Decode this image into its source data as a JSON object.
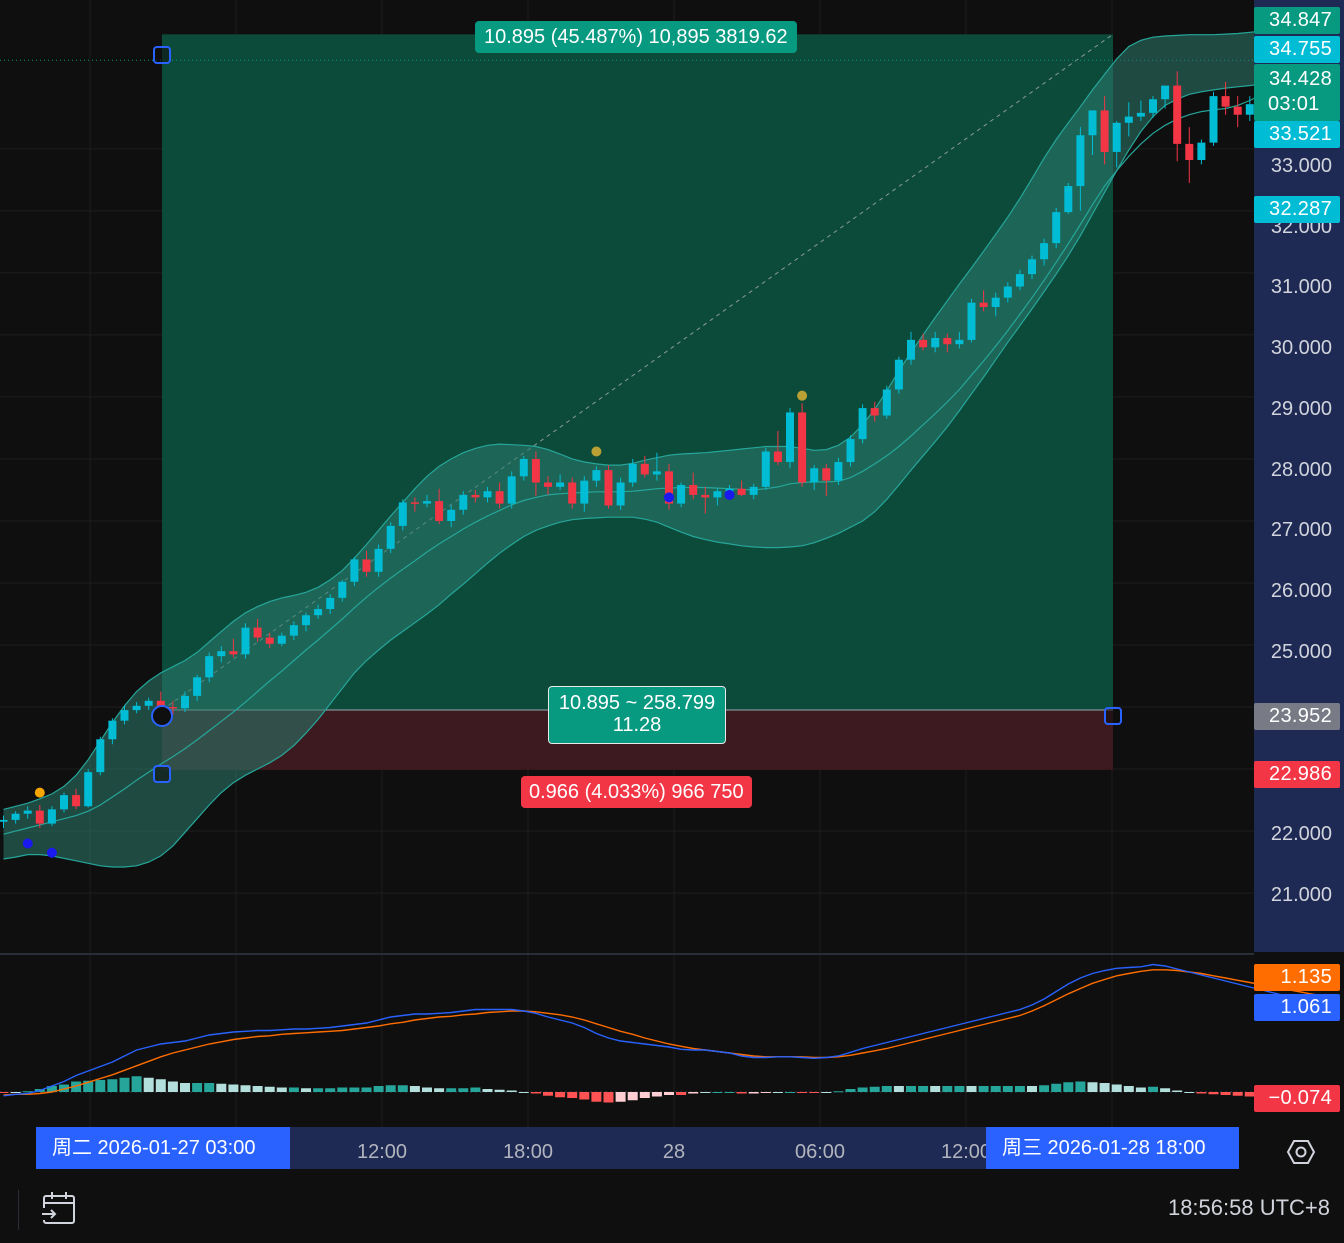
{
  "colors": {
    "background": "#0f0f0f",
    "up_candle": "#00bcd4",
    "down_candle": "#f23645",
    "profit_zone": "#0c4a3a",
    "loss_zone": "#3d1a1f",
    "bollinger_fill": "#2b7c6e",
    "macd_line": "#2962ff",
    "signal_line": "#ff6d00",
    "price_axis_panel": "#1e2a54"
  },
  "chart_data": {
    "type": "candlestick",
    "interval": "15m",
    "price_axis": {
      "ticks": [
        "33.000",
        "32.000",
        "31.000",
        "30.000",
        "29.000",
        "28.000",
        "27.000",
        "26.000",
        "25.000",
        "22.000",
        "21.000"
      ],
      "ylim": [
        20.05,
        35.4
      ]
    },
    "price_labels": [
      {
        "value": "34.847",
        "color": "#089981",
        "text2": ""
      },
      {
        "value": "34.755",
        "color": "#00bcd4",
        "text2": ""
      },
      {
        "value": "34.428",
        "color": "#089981",
        "text2": "03:01"
      },
      {
        "value": "33.521",
        "color": "#00bcd4",
        "text2": ""
      },
      {
        "value": "32.287",
        "color": "#00bcd4",
        "text2": ""
      },
      {
        "value": "23.952",
        "color": "#787b86",
        "text2": ""
      },
      {
        "value": "22.986",
        "color": "#f23645",
        "text2": ""
      }
    ],
    "time_axis": {
      "ticks": [
        "12:00",
        "18:00",
        "28",
        "06:00",
        "12:00"
      ],
      "range_start": "周二 2026-01-27   03:00",
      "range_end": "周三 2026-01-28   18:00"
    },
    "candles": [
      [
        22.15,
        22.25,
        22.05,
        22.18
      ],
      [
        22.18,
        22.32,
        22.12,
        22.28
      ],
      [
        22.28,
        22.4,
        22.2,
        22.33
      ],
      [
        22.33,
        22.42,
        22.05,
        22.12
      ],
      [
        22.12,
        22.4,
        22.08,
        22.35
      ],
      [
        22.35,
        22.62,
        22.3,
        22.58
      ],
      [
        22.58,
        22.68,
        22.35,
        22.4
      ],
      [
        22.4,
        23.0,
        22.38,
        22.95
      ],
      [
        22.95,
        23.52,
        22.9,
        23.48
      ],
      [
        23.48,
        23.82,
        23.4,
        23.78
      ],
      [
        23.78,
        24.02,
        23.72,
        23.95
      ],
      [
        23.95,
        24.08,
        23.9,
        24.02
      ],
      [
        24.02,
        24.15,
        23.95,
        24.1
      ],
      [
        24.1,
        24.25,
        23.95,
        24.0
      ],
      [
        24.0,
        24.1,
        23.88,
        23.98
      ],
      [
        23.98,
        24.25,
        23.92,
        24.18
      ],
      [
        24.18,
        24.52,
        24.1,
        24.48
      ],
      [
        24.48,
        24.88,
        24.4,
        24.82
      ],
      [
        24.82,
        24.98,
        24.72,
        24.9
      ],
      [
        24.9,
        25.1,
        24.8,
        24.85
      ],
      [
        24.85,
        25.35,
        24.78,
        25.28
      ],
      [
        25.28,
        25.42,
        25.05,
        25.12
      ],
      [
        25.12,
        25.2,
        24.95,
        25.02
      ],
      [
        25.02,
        25.2,
        24.98,
        25.15
      ],
      [
        25.15,
        25.38,
        25.08,
        25.32
      ],
      [
        25.32,
        25.52,
        25.22,
        25.48
      ],
      [
        25.48,
        25.65,
        25.42,
        25.58
      ],
      [
        25.58,
        25.82,
        25.5,
        25.76
      ],
      [
        25.76,
        26.05,
        25.7,
        26.02
      ],
      [
        26.02,
        26.42,
        25.95,
        26.38
      ],
      [
        26.38,
        26.52,
        26.1,
        26.18
      ],
      [
        26.18,
        26.62,
        26.1,
        26.55
      ],
      [
        26.55,
        26.98,
        26.48,
        26.92
      ],
      [
        26.92,
        27.35,
        26.85,
        27.3
      ],
      [
        27.3,
        27.38,
        27.15,
        27.28
      ],
      [
        27.28,
        27.42,
        27.22,
        27.32
      ],
      [
        27.32,
        27.52,
        26.95,
        27.0
      ],
      [
        27.0,
        27.25,
        26.9,
        27.18
      ],
      [
        27.18,
        27.48,
        27.1,
        27.42
      ],
      [
        27.42,
        27.5,
        27.3,
        27.38
      ],
      [
        27.38,
        27.55,
        27.3,
        27.48
      ],
      [
        27.48,
        27.62,
        27.2,
        27.28
      ],
      [
        27.28,
        27.8,
        27.2,
        27.72
      ],
      [
        27.72,
        28.05,
        27.65,
        28.0
      ],
      [
        28.0,
        28.12,
        27.4,
        27.62
      ],
      [
        27.62,
        27.72,
        27.42,
        27.55
      ],
      [
        27.55,
        27.75,
        27.5,
        27.62
      ],
      [
        27.62,
        27.7,
        27.2,
        27.28
      ],
      [
        27.28,
        27.72,
        27.15,
        27.65
      ],
      [
        27.65,
        27.88,
        27.55,
        27.82
      ],
      [
        27.82,
        27.9,
        27.2,
        27.25
      ],
      [
        27.25,
        27.7,
        27.18,
        27.62
      ],
      [
        27.62,
        28.0,
        27.55,
        27.92
      ],
      [
        27.92,
        28.05,
        27.7,
        27.75
      ],
      [
        27.75,
        28.1,
        27.65,
        27.8
      ],
      [
        27.8,
        27.92,
        27.18,
        27.28
      ],
      [
        27.28,
        27.62,
        27.22,
        27.58
      ],
      [
        27.58,
        27.78,
        27.35,
        27.42
      ],
      [
        27.42,
        27.55,
        27.12,
        27.38
      ],
      [
        27.38,
        27.52,
        27.25,
        27.48
      ],
      [
        27.48,
        27.58,
        27.36,
        27.52
      ],
      [
        27.52,
        27.65,
        27.4,
        27.42
      ],
      [
        27.42,
        27.6,
        27.35,
        27.55
      ],
      [
        27.55,
        28.18,
        27.5,
        28.12
      ],
      [
        28.12,
        28.45,
        27.9,
        27.95
      ],
      [
        27.95,
        28.82,
        27.85,
        28.75
      ],
      [
        28.75,
        28.9,
        27.55,
        27.62
      ],
      [
        27.62,
        27.9,
        27.5,
        27.85
      ],
      [
        27.85,
        27.92,
        27.4,
        27.65
      ],
      [
        27.65,
        28.02,
        27.58,
        27.95
      ],
      [
        27.95,
        28.38,
        27.88,
        28.32
      ],
      [
        28.32,
        28.88,
        28.25,
        28.82
      ],
      [
        28.82,
        28.92,
        28.6,
        28.7
      ],
      [
        28.7,
        29.18,
        28.65,
        29.12
      ],
      [
        29.12,
        29.65,
        29.05,
        29.6
      ],
      [
        29.6,
        30.05,
        29.52,
        29.92
      ],
      [
        29.92,
        30.02,
        29.75,
        29.8
      ],
      [
        29.8,
        30.05,
        29.72,
        29.95
      ],
      [
        29.95,
        30.02,
        29.72,
        29.85
      ],
      [
        29.85,
        30.05,
        29.78,
        29.92
      ],
      [
        29.92,
        30.58,
        29.88,
        30.52
      ],
      [
        30.52,
        30.72,
        30.38,
        30.45
      ],
      [
        30.45,
        30.68,
        30.3,
        30.6
      ],
      [
        30.6,
        30.85,
        30.52,
        30.78
      ],
      [
        30.78,
        31.05,
        30.72,
        30.98
      ],
      [
        30.98,
        31.28,
        30.9,
        31.22
      ],
      [
        31.22,
        31.55,
        31.12,
        31.48
      ],
      [
        31.48,
        32.05,
        31.4,
        31.98
      ],
      [
        31.98,
        32.45,
        31.95,
        32.4
      ],
      [
        32.4,
        33.35,
        32.0,
        33.22
      ],
      [
        33.22,
        33.45,
        32.9,
        33.62
      ],
      [
        33.62,
        33.85,
        32.75,
        32.95
      ],
      [
        32.95,
        33.45,
        32.7,
        33.42
      ],
      [
        33.42,
        33.75,
        33.2,
        33.52
      ],
      [
        33.52,
        33.78,
        33.45,
        33.58
      ],
      [
        33.58,
        33.85,
        33.5,
        33.8
      ],
      [
        33.8,
        34.0,
        33.65,
        34.02
      ],
      [
        34.02,
        34.25,
        32.8,
        33.08
      ],
      [
        33.08,
        33.35,
        32.45,
        32.82
      ],
      [
        32.82,
        33.15,
        32.75,
        33.1
      ],
      [
        33.1,
        33.92,
        33.05,
        33.85
      ],
      [
        33.85,
        34.08,
        33.55,
        33.68
      ],
      [
        33.68,
        33.85,
        33.35,
        33.55
      ],
      [
        33.55,
        33.85,
        33.45,
        33.72
      ],
      [
        33.72,
        33.85,
        33.5,
        33.75
      ],
      [
        33.75,
        34.02,
        33.7,
        33.92
      ],
      [
        33.92,
        34.65,
        33.88,
        34.6
      ],
      [
        34.6,
        34.72,
        34.2,
        34.32
      ],
      [
        34.32,
        34.76,
        34.22,
        34.36
      ]
    ],
    "bollinger": {
      "basis": [
        21.95,
        22.0,
        22.05,
        22.1,
        22.15,
        22.2,
        22.25,
        22.32,
        22.42,
        22.55,
        22.68,
        22.82,
        22.95,
        23.08,
        23.2,
        23.33,
        23.47,
        23.62,
        23.77,
        23.92,
        24.08,
        24.25,
        24.42,
        24.58,
        24.75,
        24.92,
        25.08,
        25.25,
        25.42,
        25.6,
        25.77,
        25.93,
        26.08,
        26.22,
        26.36,
        26.5,
        26.63,
        26.75,
        26.87,
        26.98,
        27.08,
        27.17,
        27.26,
        27.33,
        27.38,
        27.42,
        27.44,
        27.45,
        27.46,
        27.47,
        27.47,
        27.47,
        27.48,
        27.5,
        27.52,
        27.53,
        27.54,
        27.54,
        27.54,
        27.53,
        27.52,
        27.51,
        27.5,
        27.52,
        27.55,
        27.6,
        27.62,
        27.63,
        27.63,
        27.64,
        27.7,
        27.8,
        27.92,
        28.05,
        28.2,
        28.37,
        28.55,
        28.73,
        28.92,
        29.12,
        29.35,
        29.58,
        29.82,
        30.07,
        30.33,
        30.6,
        30.88,
        31.17,
        31.47,
        31.78,
        32.1,
        32.4,
        32.65,
        32.88,
        33.08,
        33.25,
        33.38,
        33.48,
        33.55,
        33.6,
        33.63,
        33.65,
        33.7,
        33.78,
        33.88,
        34.0,
        34.12,
        34.22,
        34.32,
        34.4,
        34.45
      ],
      "upper": [
        22.35,
        22.4,
        22.45,
        22.52,
        22.6,
        22.72,
        22.9,
        23.15,
        23.45,
        23.75,
        24.02,
        24.25,
        24.42,
        24.55,
        24.65,
        24.75,
        24.88,
        25.05,
        25.22,
        25.38,
        25.52,
        25.62,
        25.7,
        25.76,
        25.8,
        25.85,
        25.93,
        26.05,
        26.2,
        26.4,
        26.62,
        26.85,
        27.08,
        27.3,
        27.52,
        27.72,
        27.88,
        28.0,
        28.1,
        28.17,
        28.22,
        28.24,
        28.23,
        28.22,
        28.2,
        28.15,
        28.08,
        28.0,
        27.95,
        27.92,
        27.9,
        27.9,
        27.93,
        27.98,
        28.02,
        28.06,
        28.08,
        28.09,
        28.1,
        28.12,
        28.14,
        28.16,
        28.18,
        28.2,
        28.2,
        28.2,
        28.17,
        28.14,
        28.15,
        28.22,
        28.35,
        28.55,
        28.8,
        29.1,
        29.42,
        29.72,
        30.0,
        30.28,
        30.55,
        30.82,
        31.08,
        31.35,
        31.62,
        31.9,
        32.2,
        32.52,
        32.85,
        33.15,
        33.42,
        33.68,
        33.95,
        34.2,
        34.45,
        34.65,
        34.75,
        34.8,
        34.82,
        34.83,
        34.84,
        34.84,
        34.84,
        34.85,
        34.86,
        34.88,
        34.9,
        34.85,
        34.76,
        34.72,
        34.7,
        34.72,
        34.76
      ],
      "lower": [
        21.55,
        21.58,
        21.62,
        21.62,
        21.6,
        21.56,
        21.52,
        21.48,
        21.44,
        21.42,
        21.42,
        21.44,
        21.5,
        21.6,
        21.76,
        21.98,
        22.2,
        22.42,
        22.62,
        22.78,
        22.9,
        23.0,
        23.1,
        23.22,
        23.38,
        23.58,
        23.8,
        24.05,
        24.3,
        24.55,
        24.75,
        24.92,
        25.08,
        25.22,
        25.36,
        25.5,
        25.65,
        25.82,
        25.98,
        26.15,
        26.32,
        26.48,
        26.62,
        26.75,
        26.85,
        26.92,
        26.98,
        27.02,
        27.04,
        27.05,
        27.06,
        27.06,
        27.06,
        27.03,
        26.98,
        26.9,
        26.82,
        26.75,
        26.7,
        26.66,
        26.63,
        26.6,
        26.58,
        26.57,
        26.57,
        26.58,
        26.6,
        26.65,
        26.72,
        26.8,
        26.9,
        27.0,
        27.15,
        27.35,
        27.58,
        27.82,
        28.05,
        28.28,
        28.52,
        28.78,
        29.05,
        29.32,
        29.6,
        29.88,
        30.15,
        30.42,
        30.7,
        30.98,
        31.28,
        31.6,
        31.95,
        32.3,
        32.65,
        32.98,
        33.28,
        33.52,
        33.7,
        33.8,
        33.88,
        33.92,
        33.95,
        33.98,
        34.0,
        34.02,
        34.05,
        34.08,
        34.1,
        34.15,
        34.2,
        34.25,
        34.28
      ]
    },
    "markers": [
      {
        "bar": 3,
        "price": 22.62,
        "color": "#f7a600"
      },
      {
        "bar": 2,
        "price": 21.8,
        "color": "#1a1aee"
      },
      {
        "bar": 4,
        "price": 21.65,
        "color": "#1a1aee"
      },
      {
        "bar": 49,
        "price": 28.12,
        "color": "#b8a035"
      },
      {
        "bar": 66,
        "price": 29.02,
        "color": "#b8a035"
      },
      {
        "bar": 55,
        "price": 27.38,
        "color": "#1a1aee"
      },
      {
        "bar": 60,
        "price": 27.42,
        "color": "#1a1aee"
      }
    ],
    "position": {
      "type": "long",
      "entry": 23.952,
      "target": 34.847,
      "stop": 22.986,
      "profit_label": "10.895 (45.487%) 10,895 3819.62",
      "loss_label": "0.966 (4.033%) 966 750",
      "mid_label_line1": "10.895 ~ 258.799",
      "mid_label_line2": "11.28"
    },
    "macd": {
      "labels": {
        "signal": "1.135",
        "macd": "1.061",
        "histogram": "−0.074"
      },
      "macd_line": [
        -0.05,
        -0.03,
        -0.02,
        0.02,
        0.08,
        0.14,
        0.22,
        0.28,
        0.34,
        0.4,
        0.48,
        0.56,
        0.6,
        0.64,
        0.66,
        0.68,
        0.72,
        0.76,
        0.78,
        0.8,
        0.81,
        0.82,
        0.82,
        0.83,
        0.84,
        0.84,
        0.85,
        0.86,
        0.88,
        0.9,
        0.92,
        0.96,
        1.0,
        1.02,
        1.04,
        1.04,
        1.05,
        1.06,
        1.08,
        1.1,
        1.1,
        1.1,
        1.1,
        1.08,
        1.05,
        1.0,
        0.96,
        0.92,
        0.86,
        0.78,
        0.72,
        0.68,
        0.66,
        0.64,
        0.62,
        0.6,
        0.57,
        0.56,
        0.56,
        0.54,
        0.52,
        0.48,
        0.46,
        0.46,
        0.47,
        0.47,
        0.46,
        0.45,
        0.46,
        0.48,
        0.53,
        0.58,
        0.62,
        0.66,
        0.7,
        0.74,
        0.78,
        0.82,
        0.86,
        0.9,
        0.94,
        0.98,
        1.02,
        1.06,
        1.1,
        1.16,
        1.24,
        1.34,
        1.44,
        1.52,
        1.58,
        1.62,
        1.65,
        1.66,
        1.67,
        1.7,
        1.68,
        1.64,
        1.6,
        1.56,
        1.52,
        1.48,
        1.44,
        1.4,
        1.36,
        1.32,
        1.28,
        1.24,
        1.22,
        1.2,
        1.19
      ],
      "signal_line": [
        -0.04,
        -0.03,
        -0.03,
        -0.02,
        0.0,
        0.04,
        0.08,
        0.13,
        0.18,
        0.23,
        0.29,
        0.35,
        0.41,
        0.47,
        0.52,
        0.56,
        0.6,
        0.64,
        0.67,
        0.7,
        0.72,
        0.74,
        0.75,
        0.77,
        0.78,
        0.79,
        0.8,
        0.81,
        0.82,
        0.84,
        0.86,
        0.88,
        0.91,
        0.93,
        0.96,
        0.98,
        1.0,
        1.01,
        1.03,
        1.04,
        1.06,
        1.07,
        1.08,
        1.08,
        1.07,
        1.05,
        1.03,
        1.0,
        0.96,
        0.91,
        0.86,
        0.81,
        0.77,
        0.72,
        0.68,
        0.64,
        0.61,
        0.58,
        0.56,
        0.54,
        0.52,
        0.5,
        0.48,
        0.47,
        0.47,
        0.47,
        0.47,
        0.46,
        0.46,
        0.47,
        0.49,
        0.52,
        0.55,
        0.58,
        0.62,
        0.66,
        0.7,
        0.74,
        0.78,
        0.82,
        0.86,
        0.9,
        0.94,
        0.98,
        1.02,
        1.08,
        1.15,
        1.23,
        1.31,
        1.38,
        1.45,
        1.5,
        1.55,
        1.58,
        1.61,
        1.63,
        1.63,
        1.62,
        1.6,
        1.58,
        1.55,
        1.52,
        1.49,
        1.46,
        1.43,
        1.4,
        1.37,
        1.34,
        1.31,
        1.28,
        1.25
      ]
    }
  },
  "footer": {
    "time": "18:56:58 UTC+8",
    "calendar_icon": "calendar-goto-icon",
    "settings_icon": "gear-icon"
  }
}
